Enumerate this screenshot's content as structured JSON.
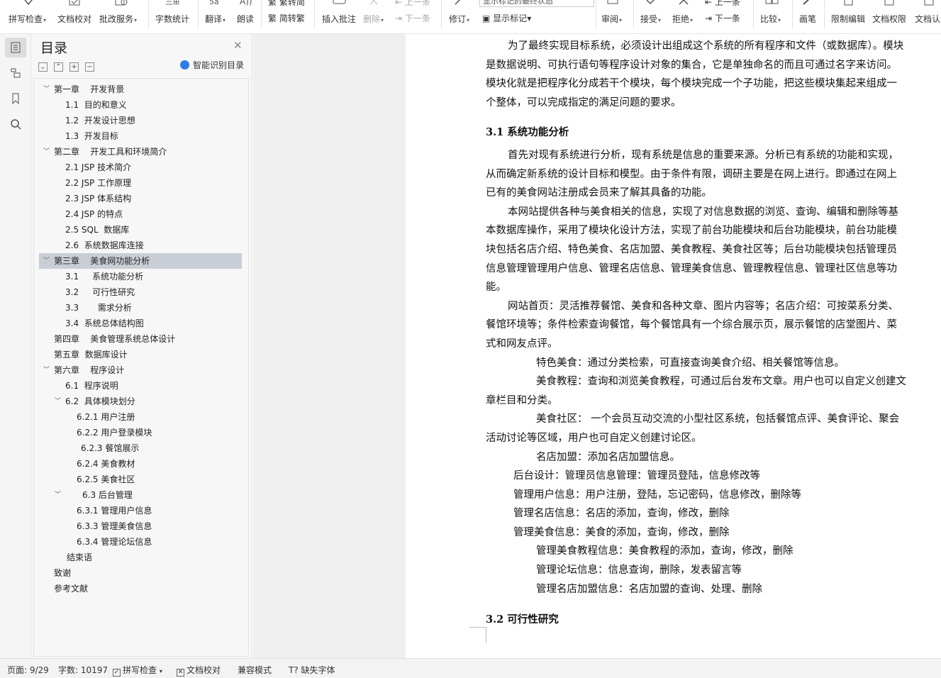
{
  "ribbon": {
    "spell_check": "拼写检查",
    "doc_proof": "文档校对",
    "batch_service": "批改服务",
    "word_count": "字数统计",
    "translate": "翻译",
    "read_aloud": "朗读",
    "trad_simp": "繁转简",
    "simp_trad": "简转繁",
    "insert_comment": "插入批注",
    "delete": "删除",
    "prev_item": "上一条",
    "next_item": "下一条",
    "revise": "修订",
    "markup_combo": "显示标记的最终状态",
    "show_markup": "显示标记",
    "review": "审阅",
    "accept": "接受",
    "reject": "拒绝",
    "compare": "比较",
    "pen": "画笔",
    "restrict_edit": "限制编辑",
    "doc_permission": "文档权限",
    "doc_cert": "文档认证"
  },
  "toc": {
    "title": "目录",
    "smart_detect": "智能识别目录",
    "items": [
      {
        "text": "第一章    开发背景"
      },
      {
        "text": "1.1  目的和意义"
      },
      {
        "text": "1.2  开发设计思想"
      },
      {
        "text": "1.3  开发目标"
      },
      {
        "text": "第二章    开发工具和环境简介"
      },
      {
        "text": "2.1 JSP 技术简介"
      },
      {
        "text": "2.2 JSP 工作原理"
      },
      {
        "text": "2.3 JSP 体系结构"
      },
      {
        "text": "2.4 JSP 的特点"
      },
      {
        "text": "2.5 SQL  数据库"
      },
      {
        "text": "2.6  系统数据库连接"
      },
      {
        "text": "第三章    美食网功能分析"
      },
      {
        "text": "3.1     系统功能分析"
      },
      {
        "text": "3.2     可行性研究"
      },
      {
        "text": "3.3       需求分析"
      },
      {
        "text": "3.4  系统总体结构图"
      },
      {
        "text": "第四章    美食管理系统总体设计"
      },
      {
        "text": "第五章  数据库设计"
      },
      {
        "text": "第六章    程序设计"
      },
      {
        "text": "6.1  程序说明"
      },
      {
        "text": "6.2  具体模块划分"
      },
      {
        "text": "6.2.1 用户注册"
      },
      {
        "text": "6.2.2 用户登录模块"
      },
      {
        "text": "6.2.3 餐馆展示"
      },
      {
        "text": "6.2.4 美食教材"
      },
      {
        "text": "6.2.5 美食社区"
      },
      {
        "text": "6.3 后台管理"
      },
      {
        "text": "6.3.1 管理用户信息"
      },
      {
        "text": "6.3.3 管理美食信息"
      },
      {
        "text": "6.3.4 管理论坛信息"
      },
      {
        "text": "结束语"
      },
      {
        "text": "致谢"
      },
      {
        "text": "参考文献"
      }
    ]
  },
  "doc": {
    "para1": [
      "为了最终实现目标系统，必须设计出组成这个系统的所有程序和文件（或数据库）。模块",
      "是数据说明、可执行语句等程序设计对象的集合，它是单独命名的而且可通过名字来访问。",
      "模块化就是把程序化分成若干个模块，每个模块完成一个子功能，把这些模块集起来组成一",
      "个整体，可以完成指定的满足问题的要求。"
    ],
    "heading31": "3.1    系统功能分析",
    "para2": [
      "首先对现有系统进行分析，现有系统是信息的重要来源。分析已有系统的功能和实现，",
      "从而确定新系统的设计目标和模型。由于条件有限，调研主要是在网上进行。即通过在网上",
      "已有的美食网站注册成会员来了解其具备的功能。",
      "本网站提供各种与美食相关的信息，实现了对信息数据的浏览、查询、编辑和删除等基",
      "本数据库操作，采用了模块化设计方法，实现了前台功能模块和后台功能模块，前台功能模",
      "块包括名店介绍、特色美食、名店加盟、美食教程、美食社区等；后台功能模块包括管理员",
      "信息管理管理用户信息、管理名店信息、管理美食信息、管理教程信息、管理社区信息等功",
      "能。",
      "网站首页：灵活推荐餐馆、美食和各种文章、图片内容等；名店介绍：可按菜系分类、",
      "餐馆环境等；条件检索查询餐馆，每个餐馆具有一个综合展示页，展示餐馆的店堂图片、菜",
      "式和网友点评。",
      "特色美食：通过分类检索，可直接查询美食介绍、相关餐馆等信息。",
      "美食教程：查询和浏览美食教程，可通过后台发布文章。用户也可以自定义创建文",
      "章栏目和分类。",
      "美食社区：  一个会员互动交流的小型社区系统，包括餐馆点评、美食评论、聚会",
      "活动讨论等区域，用户也可自定义创建讨论区。",
      "名店加盟：添加名店加盟信息。",
      "后台设计：管理员信息管理：管理员登陆，信息修改等",
      "管理用户信息：用户注册，登陆，忘记密码，信息修改，删除等",
      "管理名店信息：名店的添加，查询，修改，删除",
      "管理美食信息：美食的添加，查询，修改，删除",
      "管理美食教程信息：美食教程的添加，查询，修改，删除",
      "管理论坛信息：信息查询，删除，发表留言等",
      "管理名店加盟信息：名店加盟的查询、处理、删除"
    ],
    "heading32": "3.2    可行性研究"
  },
  "status": {
    "page": "页面: 9/29",
    "words": "字数: 10197",
    "spell": "拼写检查",
    "proof": "文档校对",
    "compat": "兼容模式",
    "missing_font": "缺失字体"
  }
}
